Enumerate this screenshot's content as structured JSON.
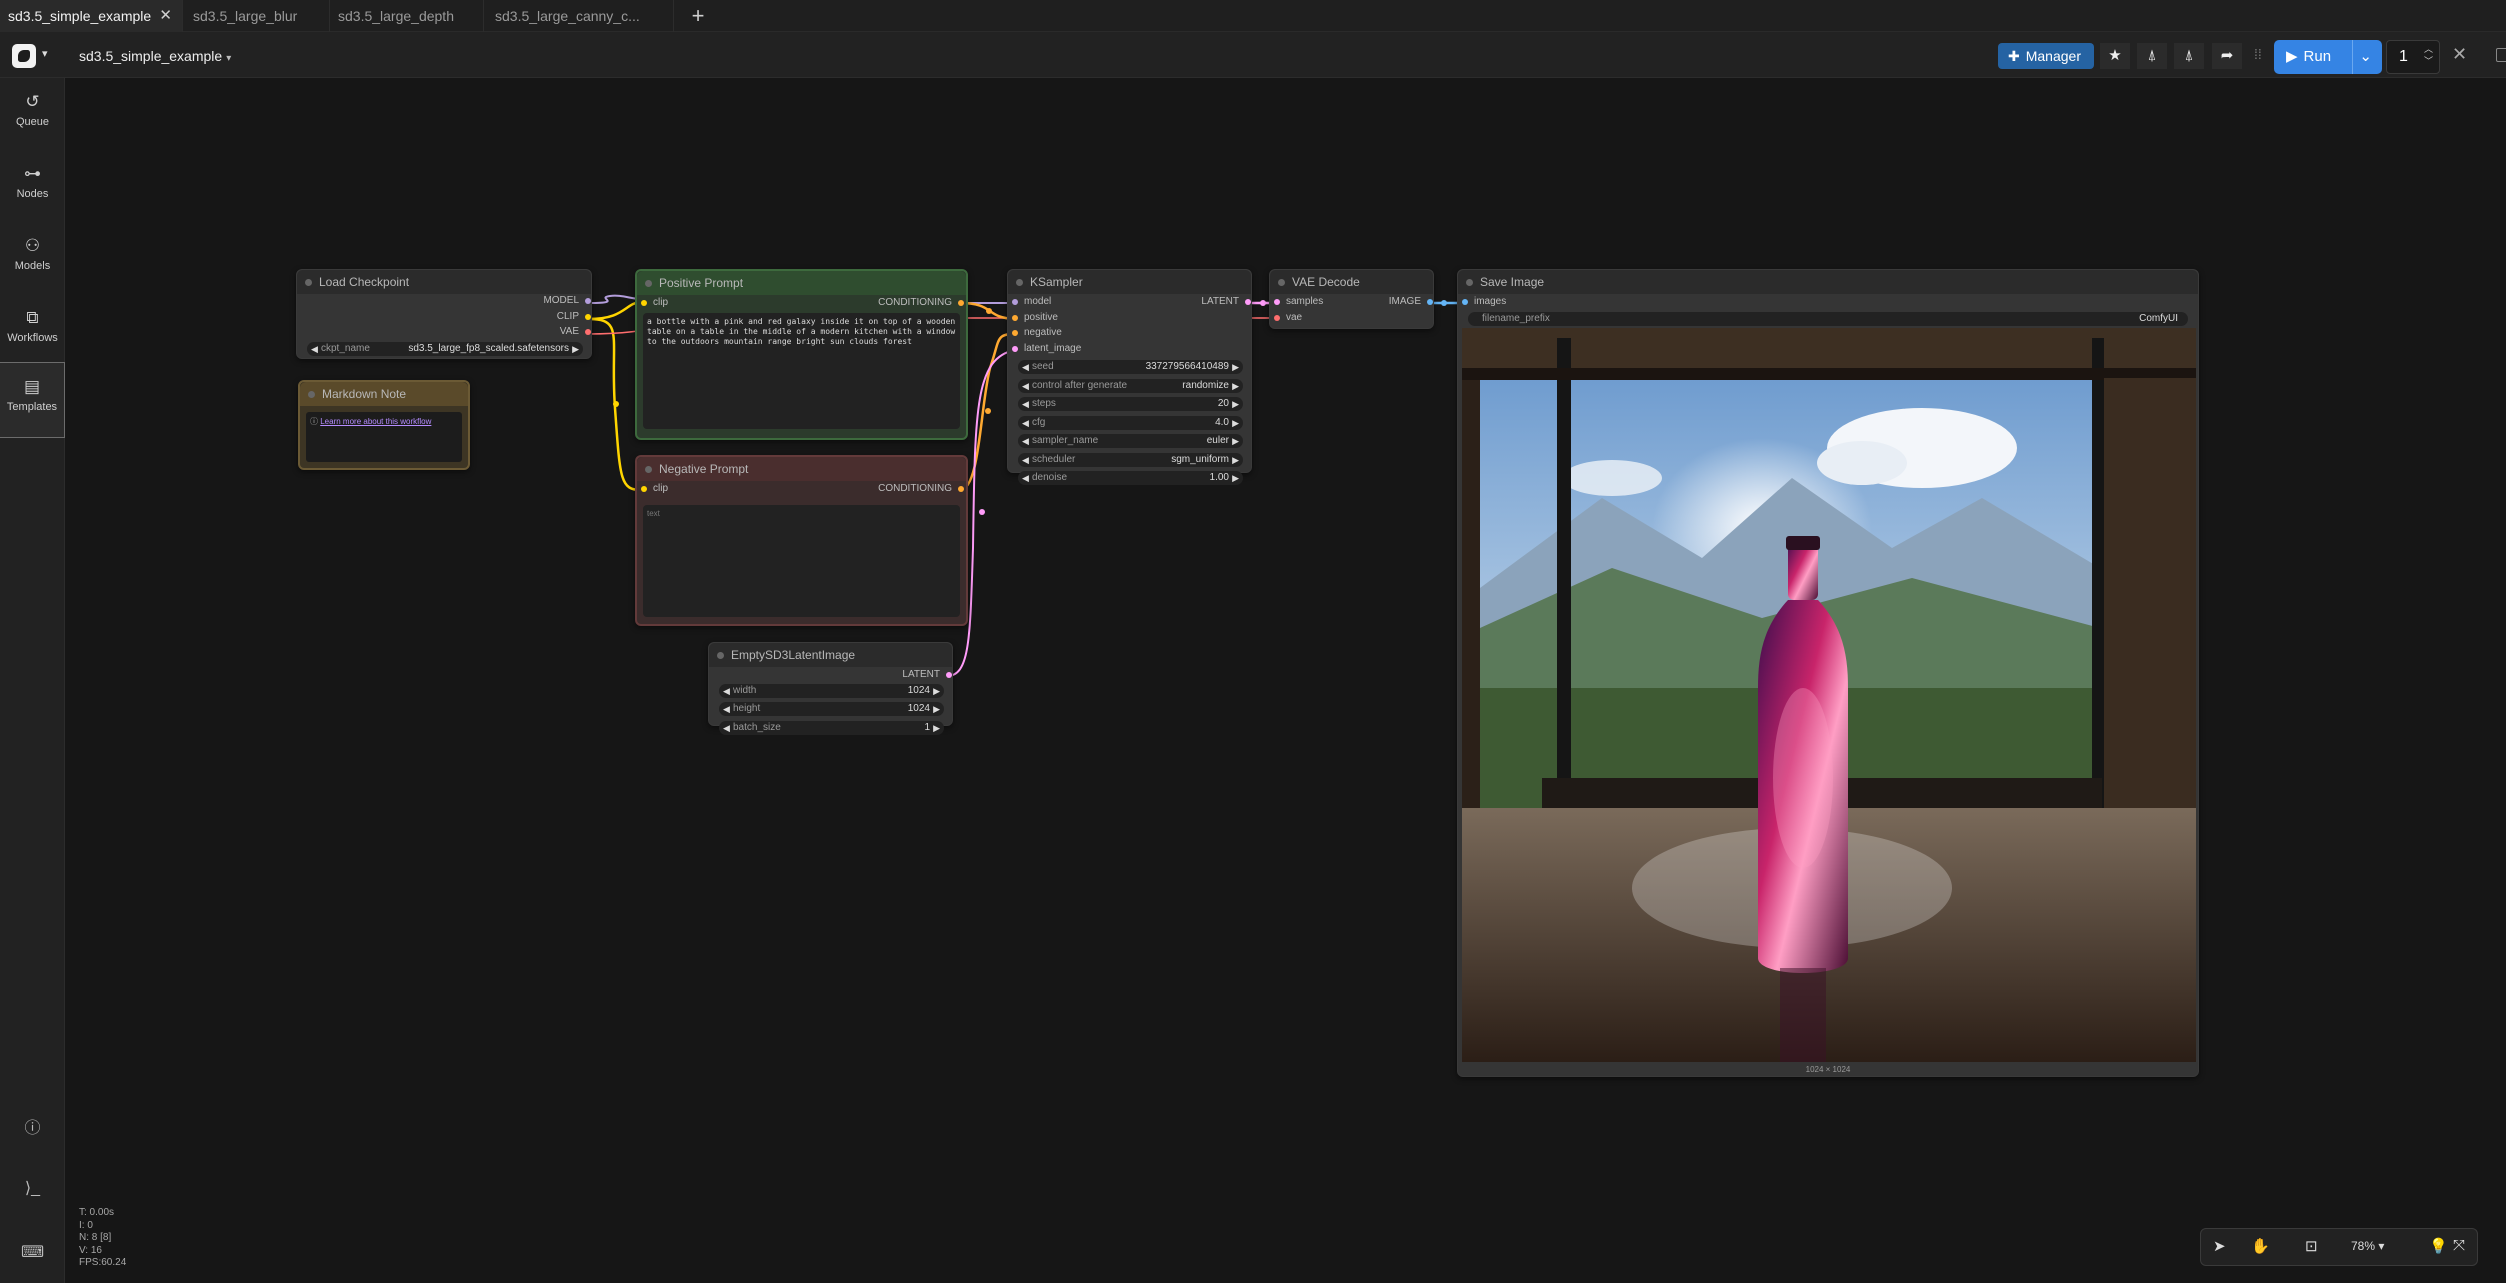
{
  "tabs": [
    {
      "label": "sd3.5_simple_example",
      "active": true
    },
    {
      "label": "sd3.5_large_blur"
    },
    {
      "label": "sd3.5_large_depth"
    },
    {
      "label": "sd3.5_large_canny_c..."
    }
  ],
  "header": {
    "workflow_title": "sd3.5_simple_example",
    "manager_label": "Manager",
    "run_label": "Run",
    "batch_count": "1"
  },
  "sidebar": {
    "items": [
      {
        "label": "Queue",
        "icon": "history-icon"
      },
      {
        "label": "Nodes",
        "icon": "nodes-icon"
      },
      {
        "label": "Models",
        "icon": "models-icon"
      },
      {
        "label": "Workflows",
        "icon": "workflows-icon"
      },
      {
        "label": "Templates",
        "icon": "templates-icon"
      }
    ]
  },
  "nodes": {
    "load_checkpoint": {
      "title": "Load Checkpoint",
      "outputs": [
        "MODEL",
        "CLIP",
        "VAE"
      ],
      "ckpt_label": "ckpt_name",
      "ckpt_value": "sd3.5_large_fp8_scaled.safetensors"
    },
    "markdown_note": {
      "title": "Markdown Note",
      "link": "Learn more about this workflow"
    },
    "positive_prompt": {
      "title": "Positive Prompt",
      "input": "clip",
      "output": "CONDITIONING",
      "text": "a bottle with a pink and red galaxy inside it on top of a wooden table on a table in the middle of a modern kitchen with a window to the outdoors mountain range bright sun clouds forest"
    },
    "negative_prompt": {
      "title": "Negative Prompt",
      "input": "clip",
      "output": "CONDITIONING",
      "placeholder": "text"
    },
    "empty_latent": {
      "title": "EmptySD3LatentImage",
      "output": "LATENT",
      "width_label": "width",
      "width_value": "1024",
      "height_label": "height",
      "height_value": "1024",
      "batch_label": "batch_size",
      "batch_value": "1"
    },
    "ksampler": {
      "title": "KSampler",
      "inputs": [
        "model",
        "positive",
        "negative",
        "latent_image"
      ],
      "output": "LATENT",
      "widgets": [
        {
          "label": "seed",
          "value": "337279566410489"
        },
        {
          "label": "control after generate",
          "value": "randomize"
        },
        {
          "label": "steps",
          "value": "20"
        },
        {
          "label": "cfg",
          "value": "4.0"
        },
        {
          "label": "sampler_name",
          "value": "euler"
        },
        {
          "label": "scheduler",
          "value": "sgm_uniform"
        },
        {
          "label": "denoise",
          "value": "1.00"
        }
      ]
    },
    "vae_decode": {
      "title": "VAE Decode",
      "inputs": [
        "samples",
        "vae"
      ],
      "output": "IMAGE"
    },
    "save_image": {
      "title": "Save Image",
      "input": "images",
      "prefix_label": "filename_prefix",
      "prefix_value": "ComfyUI",
      "image_size": "1024 × 1024"
    }
  },
  "stats": [
    "T: 0.00s",
    "I: 0",
    "N: 8 [8]",
    "V: 16",
    "FPS:60.24"
  ],
  "zoom": "78%",
  "colors": {
    "model": "#b39ddb",
    "clip": "#ffd500",
    "vae": "#ff6e6e",
    "conditioning": "#ffa931",
    "latent": "#ff9cf9",
    "image": "#64b5f6",
    "positive_node": "#2e4a2e",
    "negative_node": "#4a2c2c",
    "note_node": "#5a4a2a",
    "run_button": "#3584e4",
    "manager_button": "#2563a3"
  }
}
